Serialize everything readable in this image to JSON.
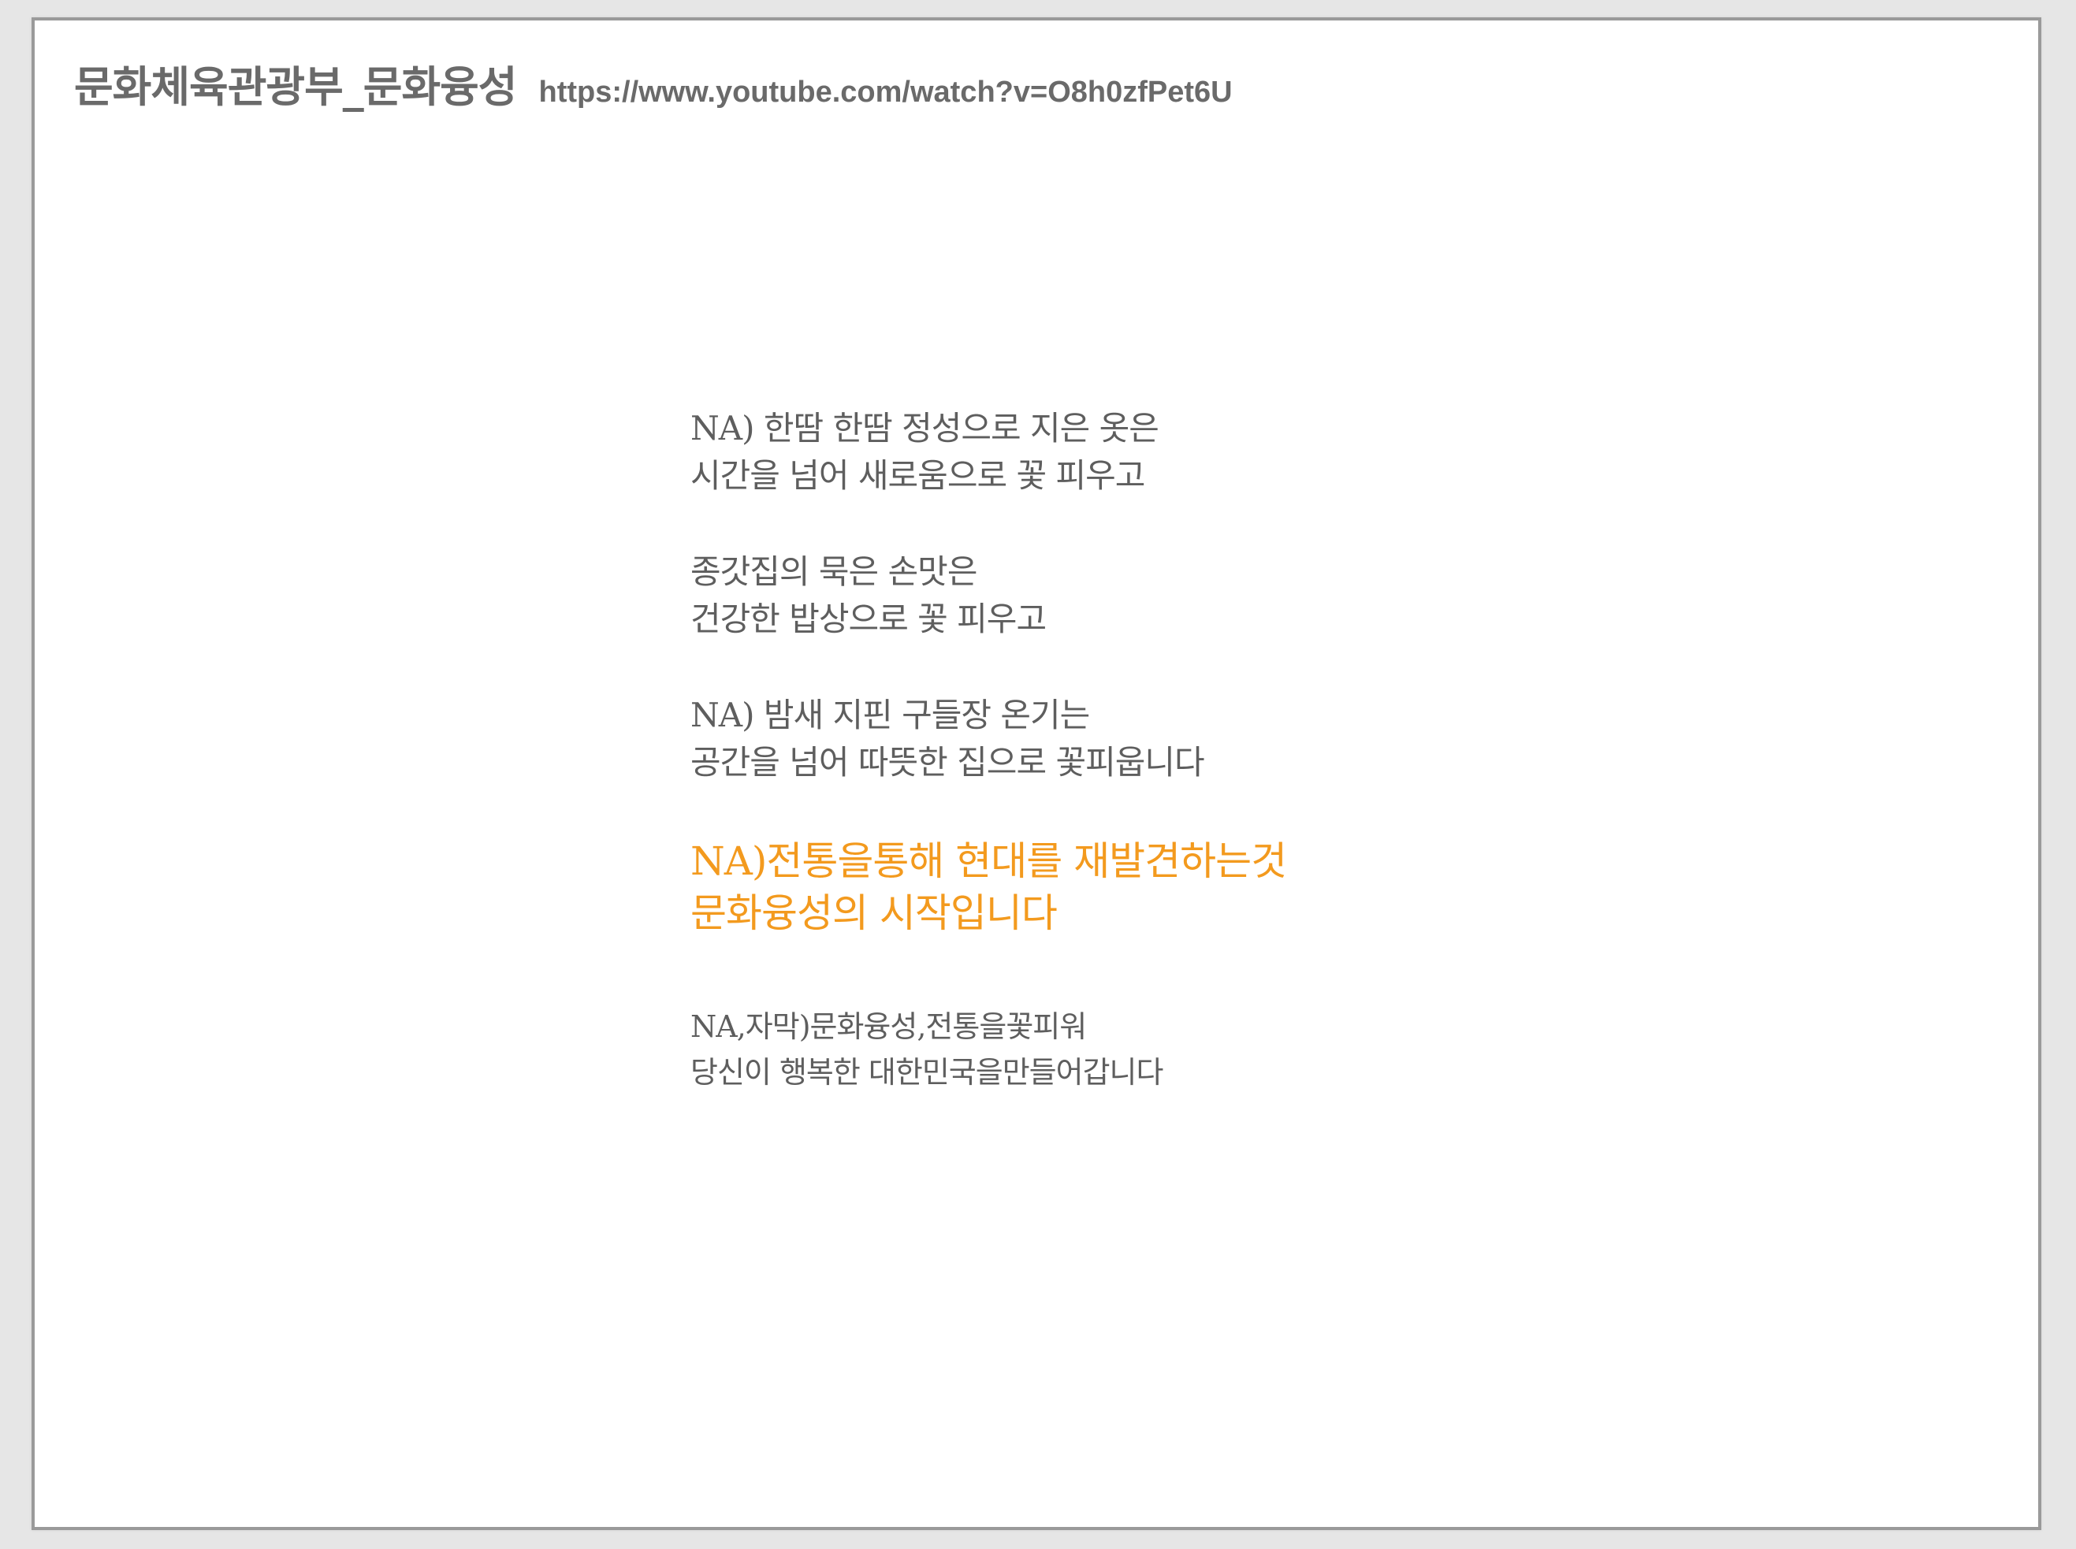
{
  "header": {
    "title": "문화체육관광부_문화융성",
    "link": "https://www.youtube.com/watch?v=O8h0zfPet6U"
  },
  "narration": {
    "stanzas": [
      {
        "lines": [
          "NA) 한땀 한땀 정성으로 지은 옷은",
          "시간을 넘어 새로움으로 꽃 피우고"
        ]
      },
      {
        "lines": [
          "종갓집의 묵은 손맛은",
          "건강한 밥상으로 꽃 피우고"
        ]
      },
      {
        "lines": [
          "NA) 밤새 지핀 구들장 온기는",
          "공간을 넘어 따뜻한 집으로 꽃피웁니다"
        ]
      },
      {
        "lines": [
          "NA)전통을통해 현대를 재발견하는것",
          "문화융성의 시작입니다"
        ]
      },
      {
        "lines": [
          "NA,자막)문화융성,전통을꽃피워",
          "당신이 행복한 대한민국을만들어갑니다"
        ]
      }
    ]
  },
  "colors": {
    "text": "#5e5e5e",
    "highlight": "#f39a1e",
    "border": "#9a9a9a",
    "backdrop": "#e6e6e6"
  }
}
